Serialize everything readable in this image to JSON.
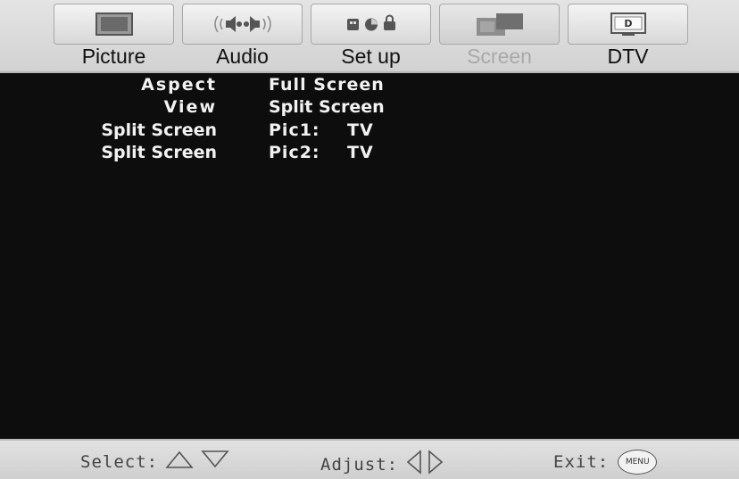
{
  "tabs": [
    {
      "label": "Picture",
      "icon": "tv-screen-icon"
    },
    {
      "label": "Audio",
      "icon": "speakers-icon"
    },
    {
      "label": "Set up",
      "icon": "setup-icons"
    },
    {
      "label": "Screen",
      "icon": "split-screen-icon",
      "active": true
    },
    {
      "label": "DTV",
      "icon": "dtv-icon"
    }
  ],
  "menu": {
    "rows": [
      {
        "label": "Aspect",
        "value": "Full Screen"
      },
      {
        "label": "View",
        "value": "Split Screen"
      },
      {
        "label": "Split Screen",
        "value": "Pic1:    TV"
      },
      {
        "label": "Split Screen",
        "value": "Pic2:    TV"
      }
    ]
  },
  "footer": {
    "select_label": "Select:",
    "adjust_label": "Adjust:",
    "exit_label": "Exit:",
    "menu_button_label": "MENU"
  },
  "colors": {
    "background": "#0d0d0d",
    "bar": "#d8d8d8",
    "active_tab_text": "#a9a9a9",
    "menu_text": "#f2f2f2"
  }
}
